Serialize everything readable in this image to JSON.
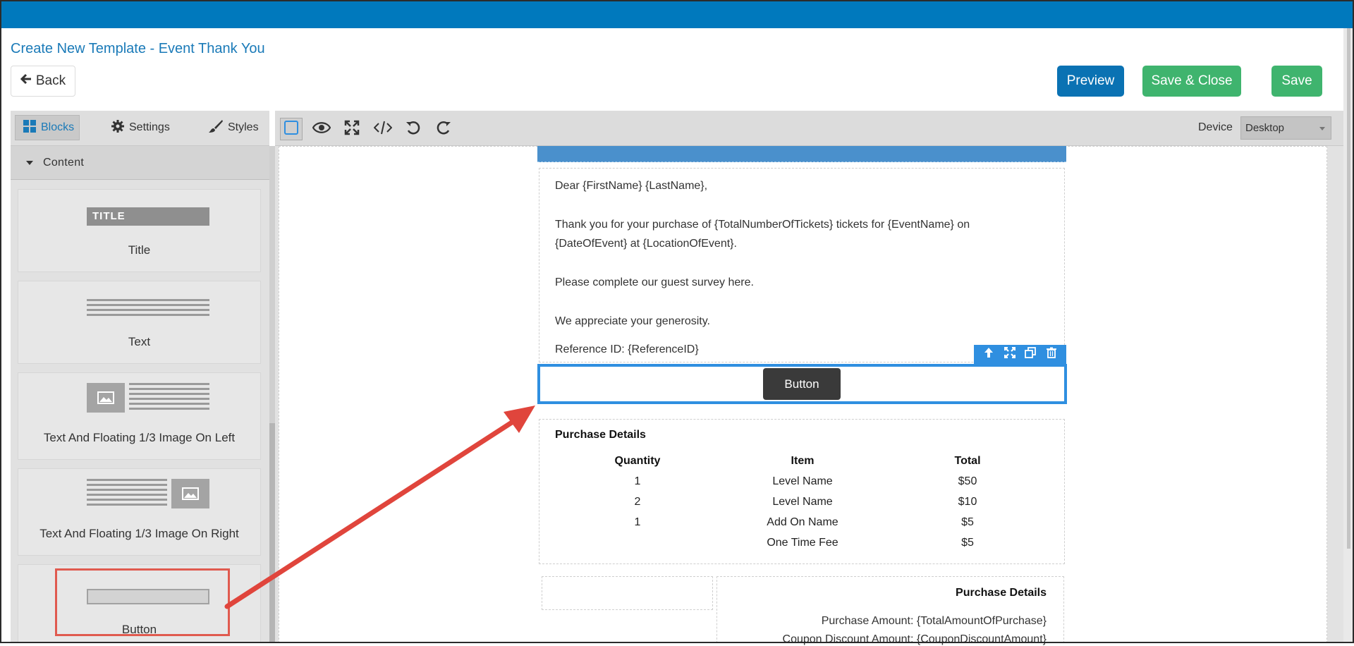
{
  "header": {
    "title": "Create New Template - Event Thank You",
    "back_label": "Back",
    "preview_label": "Preview",
    "save_close_label": "Save & Close",
    "save_label": "Save"
  },
  "left_panel": {
    "tabs": [
      {
        "label": "Blocks",
        "icon": "blocks-icon",
        "active": true
      },
      {
        "label": "Settings",
        "icon": "gear-icon",
        "active": false
      },
      {
        "label": "Styles",
        "icon": "brush-icon",
        "active": false
      }
    ],
    "section_label": "Content",
    "blocks": [
      {
        "label": "Title",
        "graphic_text": "TITLE"
      },
      {
        "label": "Text"
      },
      {
        "label": "Text And Floating 1/3 Image On Left"
      },
      {
        "label": "Text And Floating 1/3 Image On Right"
      },
      {
        "label": "Button"
      }
    ]
  },
  "toolbar": {
    "tools": [
      "select-icon",
      "eye-icon",
      "fullscreen-icon",
      "code-icon",
      "undo-icon",
      "redo-icon"
    ],
    "device_label": "Device",
    "device_value": "Desktop"
  },
  "email": {
    "greeting": "Dear {FirstName} {LastName},",
    "line1": "Thank you for your purchase of {TotalNumberOfTickets} tickets for {EventName} on",
    "line2": "{DateOfEvent} at {LocationOfEvent}.",
    "survey": "Please complete our guest survey here.",
    "appreciate": "We appreciate your generosity.",
    "reference": "Reference ID: {ReferenceID}",
    "button_label": "Button",
    "purchase": {
      "title": "Purchase Details",
      "columns": [
        "Quantity",
        "Item",
        "Total"
      ],
      "rows": [
        [
          "1",
          "Level Name",
          "$50"
        ],
        [
          "2",
          "Level Name",
          "$10"
        ],
        [
          "1",
          "Add On Name",
          "$5"
        ],
        [
          "",
          "One Time Fee",
          "$5"
        ]
      ]
    },
    "summary": {
      "title": "Purchase Details",
      "amount": "Purchase Amount: {TotalAmountOfPurchase}",
      "coupon": "Coupon Discount Amount: {CouponDiscountAmount}"
    }
  },
  "colors": {
    "topbar": "#0079bd",
    "preview": "#0a72b3",
    "save": "#3fb46e",
    "selection": "#2f8fe0",
    "annotation": "#e05a4f"
  }
}
